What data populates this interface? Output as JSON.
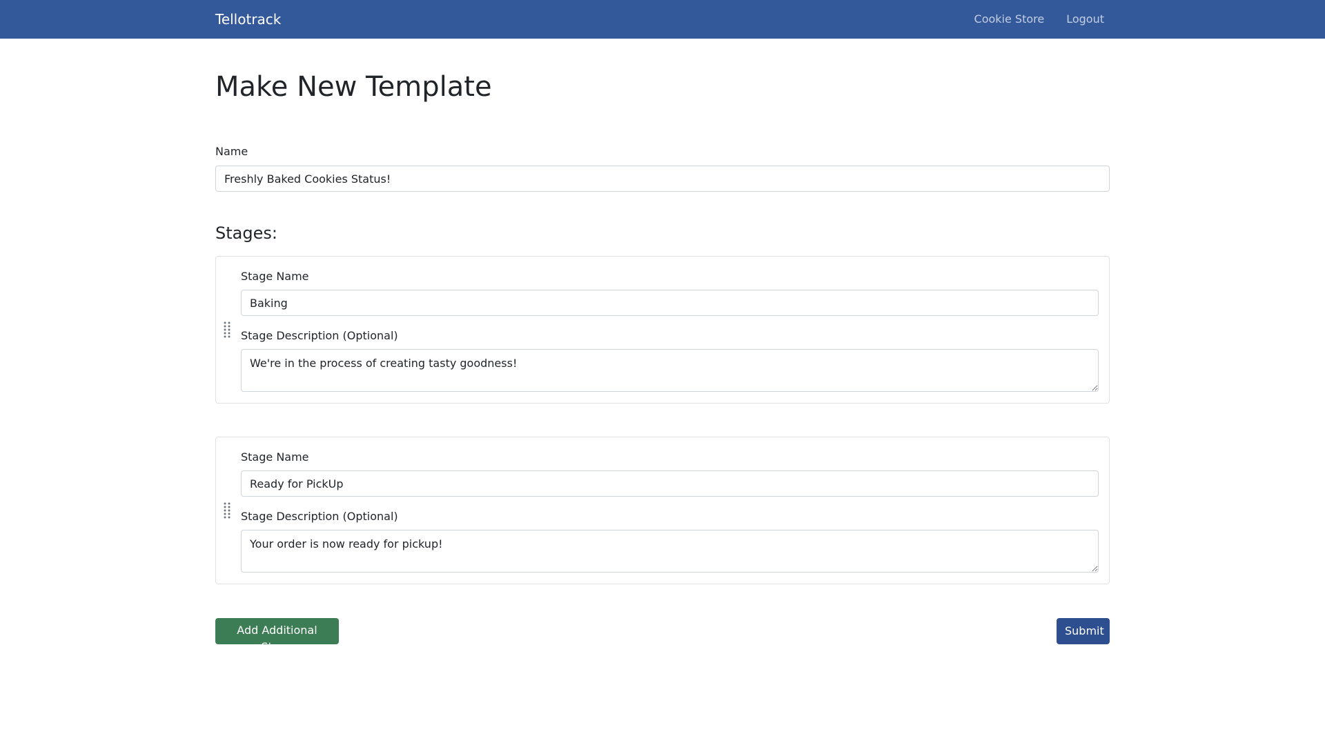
{
  "navbar": {
    "brand": "Tellotrack",
    "links": [
      "Cookie Store",
      "Logout"
    ]
  },
  "page": {
    "title": "Make New Template",
    "name_label": "Name",
    "name_value": "Freshly Baked Cookies Status!",
    "stages_heading": "Stages:"
  },
  "stages": [
    {
      "name_label": "Stage Name",
      "name_value": "Baking",
      "desc_label": "Stage Description (Optional)",
      "desc_value": "We're in the process of creating tasty goodness!"
    },
    {
      "name_label": "Stage Name",
      "name_value": "Ready for PickUp",
      "desc_label": "Stage Description (Optional)",
      "desc_value": "Your order is now ready for pickup!"
    }
  ],
  "actions": {
    "add_stage_label": "Add Additional Stage",
    "submit_label": "Submit"
  },
  "colors": {
    "navbar": "#34599b",
    "add_button": "#3d7d56",
    "submit_button": "#2e4f8f"
  },
  "icons": {
    "drag_handle": "drag-handle-icon"
  }
}
